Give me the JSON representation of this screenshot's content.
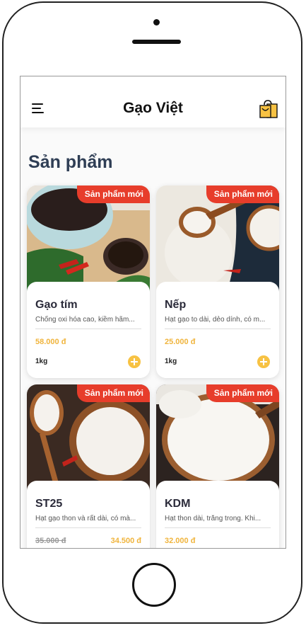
{
  "header": {
    "title": "Gạo Việt"
  },
  "section": {
    "title": "Sản phẩm"
  },
  "products": [
    {
      "badge": "Sản phẩm mới",
      "name": "Gạo tím",
      "description": "Chống oxi hóa cao, kiềm hãm...",
      "price": "58.000 đ",
      "weight": "1kg"
    },
    {
      "badge": "Sản phẩm mới",
      "name": "Nếp",
      "description": "Hạt gạo to dài, dẻo dính, có m...",
      "price": "25.000 đ",
      "weight": "1kg"
    },
    {
      "badge": "Sản phẩm mới",
      "name": "ST25",
      "description": "Hạt gạo thon và rất dài, có mà...",
      "old_price": "35.000 đ",
      "price": "34.500 đ"
    },
    {
      "badge": "Sản phẩm mới",
      "name": "KDM",
      "description": "Hạt thon dài, trắng trong. Khi...",
      "price": "32.000 đ"
    }
  ],
  "colors": {
    "badge": "#e73d2b",
    "price": "#f0b43c",
    "add_button": "#f7c243",
    "title": "#2f3e55"
  },
  "icons": {
    "menu": "menu-icon",
    "cart": "shopping-bag-icon",
    "add": "plus-icon"
  }
}
